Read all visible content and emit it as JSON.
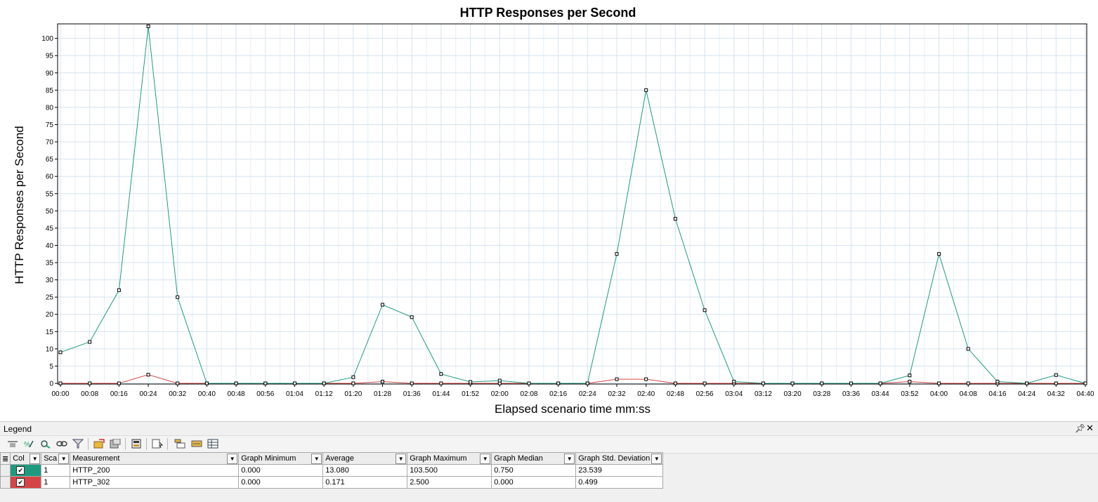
{
  "chart_data": {
    "type": "line",
    "title": "HTTP Responses per Second",
    "xlabel": "Elapsed scenario time mm:ss",
    "ylabel": "HTTP Responses per Second",
    "ylim": [
      0,
      104
    ],
    "y_ticks": [
      0,
      5,
      10,
      15,
      20,
      25,
      30,
      35,
      40,
      45,
      50,
      55,
      60,
      65,
      70,
      75,
      80,
      85,
      90,
      95,
      100
    ],
    "x": [
      "00:00",
      "00:08",
      "00:16",
      "00:24",
      "00:32",
      "00:40",
      "00:48",
      "00:56",
      "01:04",
      "01:12",
      "01:20",
      "01:28",
      "01:36",
      "01:44",
      "01:52",
      "02:00",
      "02:08",
      "02:16",
      "02:24",
      "02:32",
      "02:40",
      "02:48",
      "02:56",
      "03:04",
      "03:12",
      "03:20",
      "03:28",
      "03:36",
      "03:44",
      "03:52",
      "04:00",
      "04:08",
      "04:16",
      "04:24",
      "04:32",
      "04:40"
    ],
    "grid": true,
    "series": [
      {
        "name": "HTTP_200",
        "color": "#1f9a7f",
        "values": [
          9,
          12,
          27,
          103.5,
          25,
          0,
          0,
          0,
          0,
          0,
          1.8,
          22.8,
          19.2,
          2.7,
          0.4,
          0.8,
          0,
          0,
          0,
          37.5,
          85,
          47.7,
          21.2,
          0.5,
          0,
          0,
          0,
          0,
          0,
          2.3,
          37.5,
          10,
          0.5,
          0,
          2.4,
          0
        ]
      },
      {
        "name": "HTTP_302",
        "color": "#d64545",
        "values": [
          0,
          0,
          0,
          2.5,
          0,
          0,
          0,
          0,
          0,
          0,
          0,
          0.5,
          0,
          0,
          0,
          0,
          0,
          0,
          0,
          1.2,
          1.2,
          0,
          0,
          0,
          0,
          0,
          0,
          0,
          0,
          0.5,
          0,
          0,
          0,
          0,
          0,
          0
        ]
      }
    ]
  },
  "legend": {
    "title": "Legend",
    "pin_icon": "pin-icon",
    "close_icon": "close-icon",
    "columns": [
      "Col",
      "Sca",
      "Measurement",
      "Graph Minimum",
      "Average",
      "Graph Maximum",
      "Graph Median",
      "Graph Std. Deviation"
    ],
    "rows": [
      {
        "color": "#1f9a7f",
        "checked": "✔",
        "scale": "1",
        "measurement": "HTTP_200",
        "min": "0.000",
        "avg": "13.080",
        "max": "103.500",
        "median": "0.750",
        "std": "23.539"
      },
      {
        "color": "#d64545",
        "checked": "✔",
        "scale": "1",
        "measurement": "HTTP_302",
        "min": "0.000",
        "avg": "0.171",
        "max": "2.500",
        "median": "0.000",
        "std": "0.499"
      }
    ]
  }
}
